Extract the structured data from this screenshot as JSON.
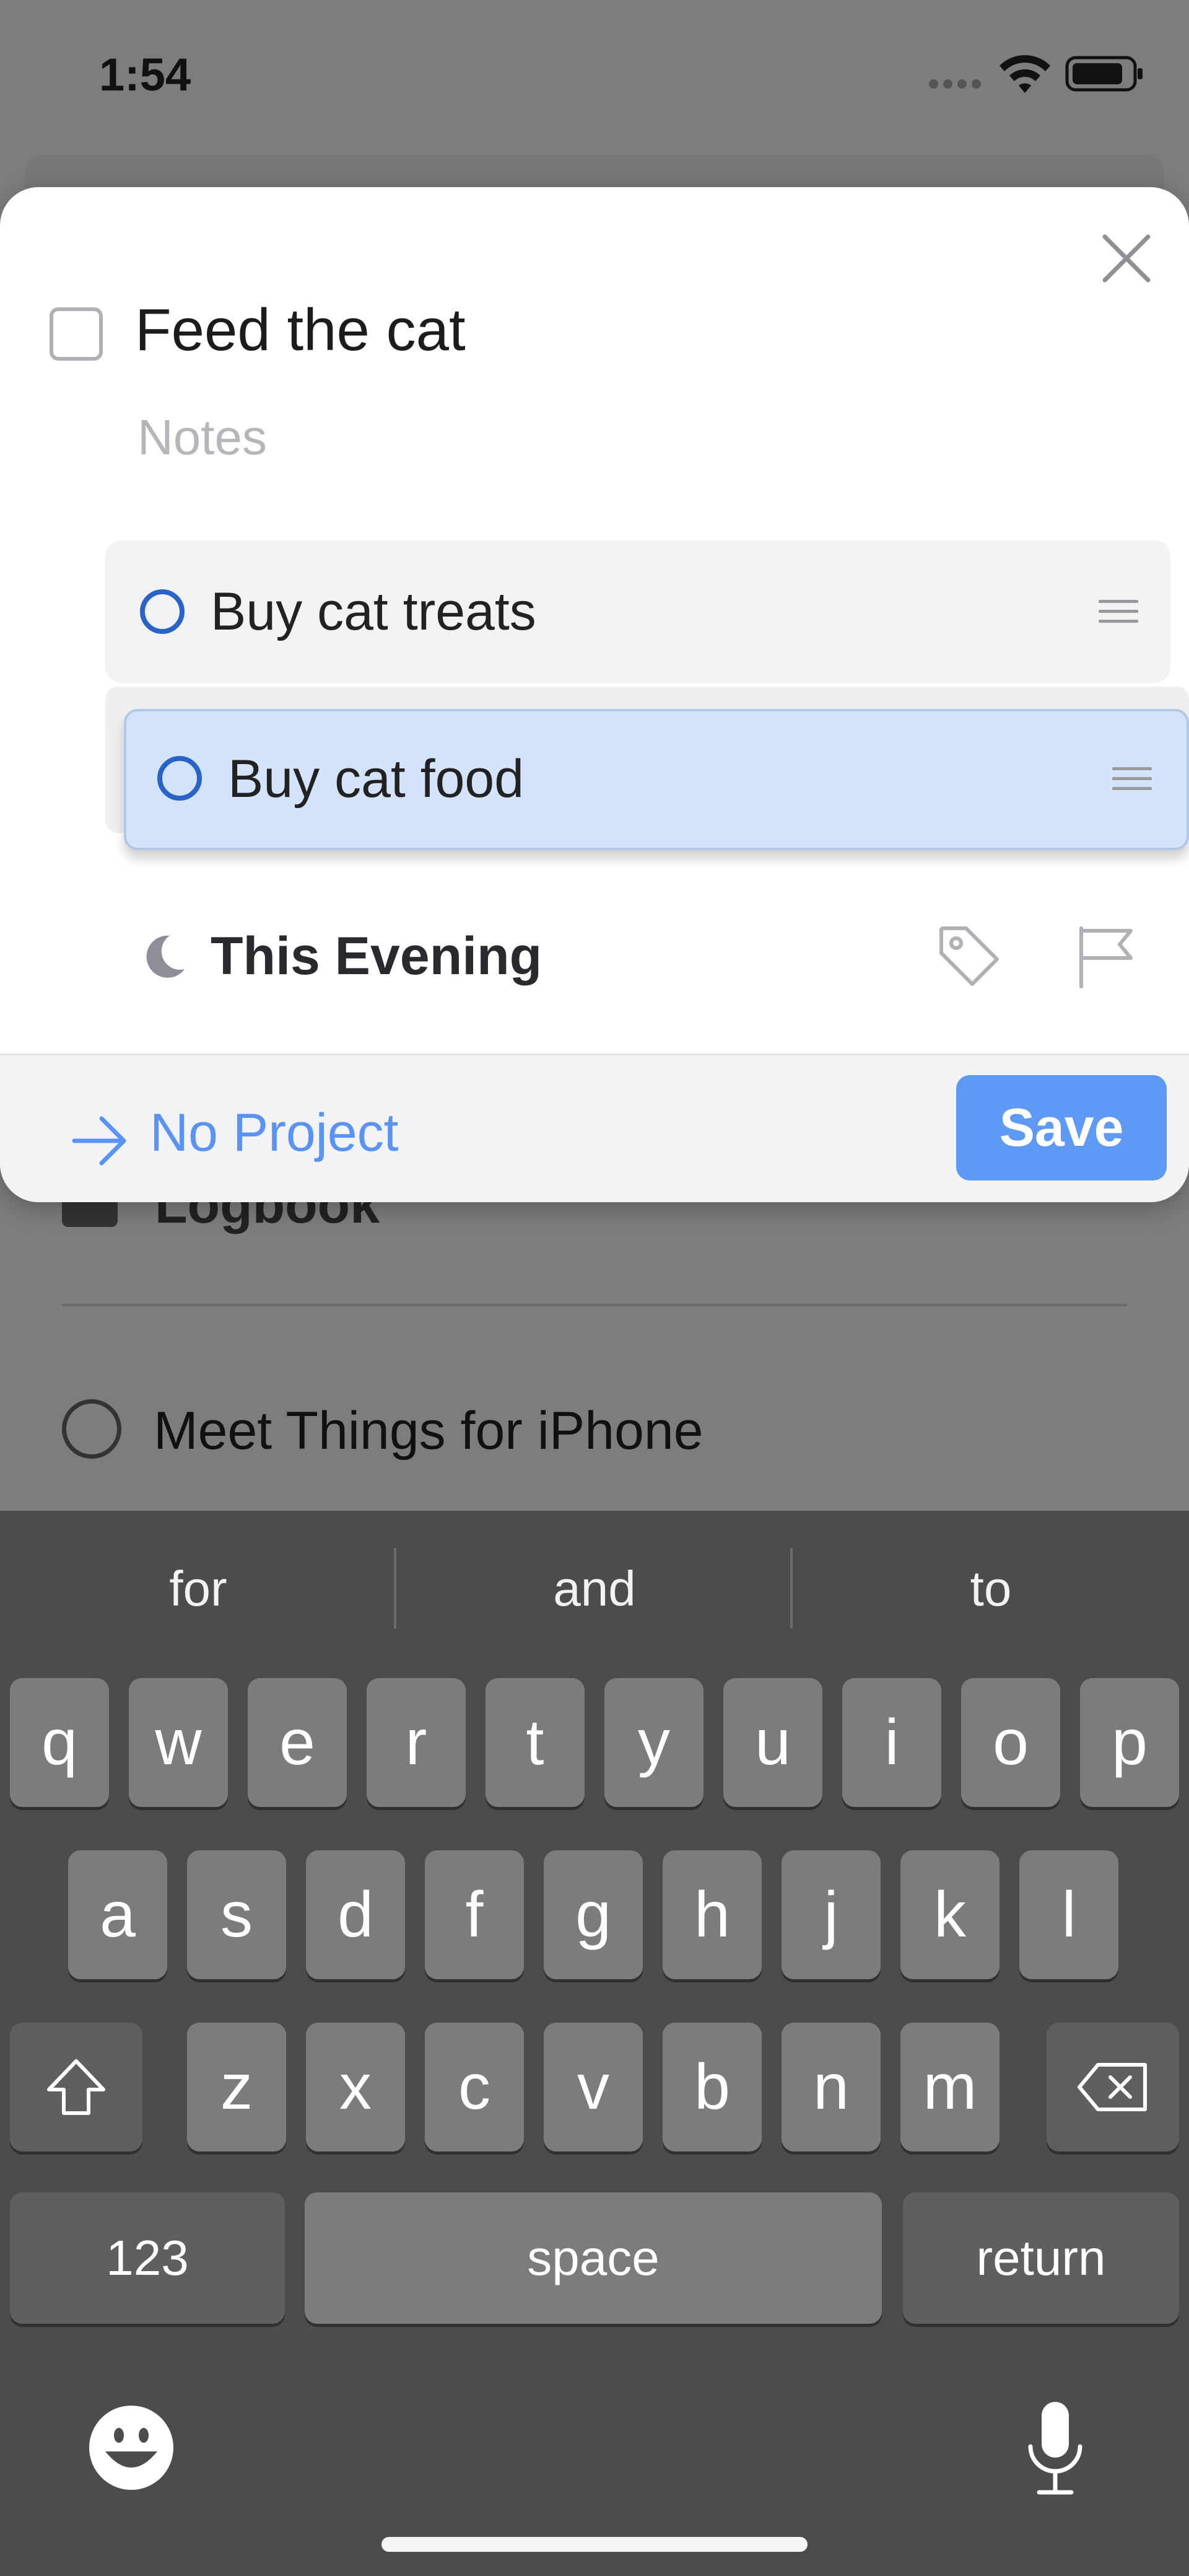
{
  "status_bar": {
    "time": "1:54"
  },
  "background": {
    "logbook_label": "Logbook",
    "todo_label": "Meet Things for iPhone"
  },
  "task": {
    "title": "Feed the cat",
    "notes_placeholder": "Notes"
  },
  "checklist": {
    "items": [
      {
        "label": "Buy cat treats",
        "state": "idle"
      },
      {
        "label": "Buy cat food",
        "state": "dragging"
      }
    ]
  },
  "when": {
    "label": "This Evening"
  },
  "footer": {
    "project_label": "No Project",
    "save_label": "Save"
  },
  "keyboard": {
    "suggestions": [
      "for",
      "and",
      "to"
    ],
    "rows": [
      [
        "q",
        "w",
        "e",
        "r",
        "t",
        "y",
        "u",
        "i",
        "o",
        "p"
      ],
      [
        "a",
        "s",
        "d",
        "f",
        "g",
        "h",
        "j",
        "k",
        "l"
      ],
      [
        "z",
        "x",
        "c",
        "v",
        "b",
        "n",
        "m"
      ]
    ],
    "numbers_label": "123",
    "space_label": "space",
    "return_label": "return"
  },
  "colors": {
    "accent_blue": "#5e9af5",
    "checklist_ring": "#2a63c8",
    "drag_highlight": "#d3e3fb",
    "keyboard_bg": "#4b4c4c"
  }
}
